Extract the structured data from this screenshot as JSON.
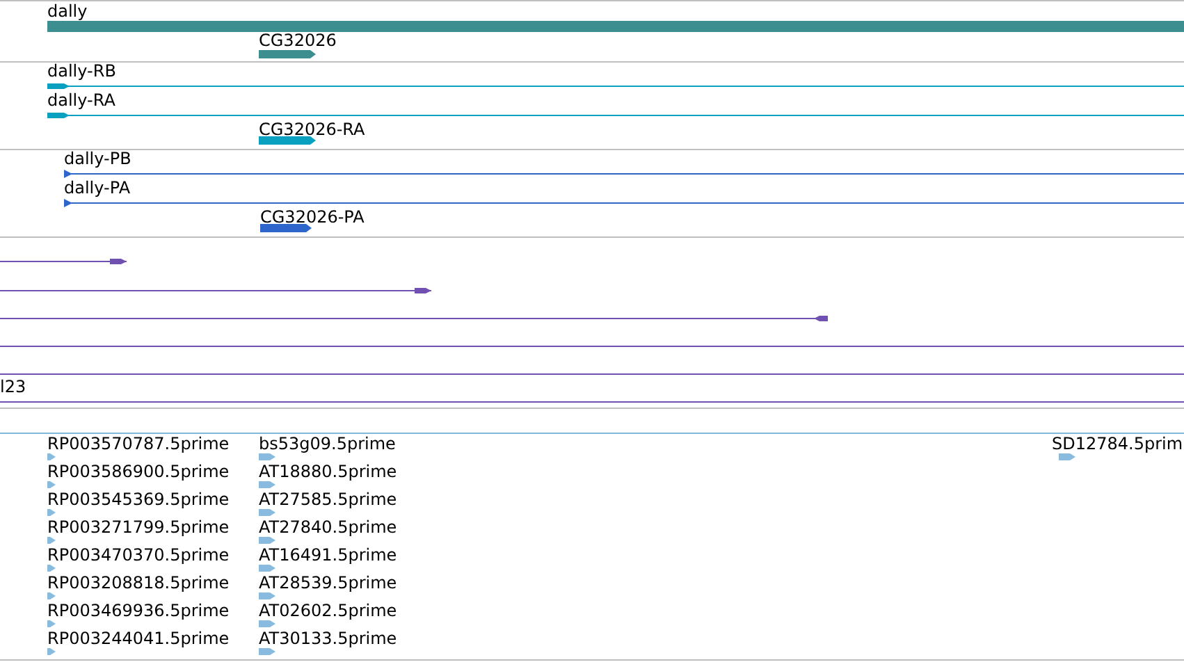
{
  "tracks": [
    {
      "kind": "gene",
      "features": [
        {
          "label": "dally",
          "kind": "plain"
        },
        {
          "label": "CG32026",
          "kind": "arrow",
          "reverse": false
        }
      ]
    },
    {
      "kind": "transcript",
      "features": [
        {
          "label": "dally-RB",
          "kind": "arrow",
          "reverse": false
        },
        {
          "label": "dally-RA",
          "kind": "arrow",
          "reverse": false
        },
        {
          "label": "CG32026-RA",
          "kind": "arrow",
          "reverse": false
        }
      ]
    },
    {
      "kind": "protein",
      "features": [
        {
          "label": "dally-PB",
          "kind": "arrow",
          "reverse": false
        },
        {
          "label": "dally-PA",
          "kind": "arrow",
          "reverse": false
        },
        {
          "label": "CG32026-PA",
          "kind": "arrow",
          "reverse": false
        }
      ]
    },
    {
      "kind": "alignment",
      "features": [
        {
          "kind": "arrow",
          "reverse": false
        },
        {
          "kind": "arrow",
          "reverse": false
        },
        {
          "kind": "arrow",
          "reverse": true
        },
        {
          "kind": "plain"
        },
        {
          "kind": "plain"
        },
        {
          "label": "l23",
          "kind": "plain"
        }
      ]
    },
    {
      "kind": "empty"
    },
    {
      "kind": "est",
      "features": [
        {
          "label": "RP003570787.5prime",
          "kind": "arrow",
          "reverse": false
        },
        {
          "label": "bs53g09.5prime",
          "kind": "arrow",
          "reverse": false
        },
        {
          "label": "SD12784.5prim",
          "kind": "arrow",
          "reverse": false
        },
        {
          "label": "RP003586900.5prime",
          "kind": "arrow",
          "reverse": false
        },
        {
          "label": "AT18880.5prime",
          "kind": "arrow",
          "reverse": false
        },
        {
          "label": "RP003545369.5prime",
          "kind": "arrow",
          "reverse": false
        },
        {
          "label": "AT27585.5prime",
          "kind": "arrow",
          "reverse": false
        },
        {
          "label": "RP003271799.5prime",
          "kind": "arrow",
          "reverse": false
        },
        {
          "label": "AT27840.5prime",
          "kind": "arrow",
          "reverse": false
        },
        {
          "label": "RP003470370.5prime",
          "kind": "arrow",
          "reverse": false
        },
        {
          "label": "AT16491.5prime",
          "kind": "arrow",
          "reverse": false
        },
        {
          "label": "RP003208818.5prime",
          "kind": "arrow",
          "reverse": false
        },
        {
          "label": "AT28539.5prime",
          "kind": "arrow",
          "reverse": false
        },
        {
          "label": "RP003469936.5prime",
          "kind": "arrow",
          "reverse": false
        },
        {
          "label": "AT02602.5prime",
          "kind": "arrow",
          "reverse": false
        },
        {
          "label": "RP003244041.5prime",
          "kind": "arrow",
          "reverse": false
        },
        {
          "label": "AT30133.5prime",
          "kind": "arrow",
          "reverse": false
        }
      ]
    }
  ]
}
